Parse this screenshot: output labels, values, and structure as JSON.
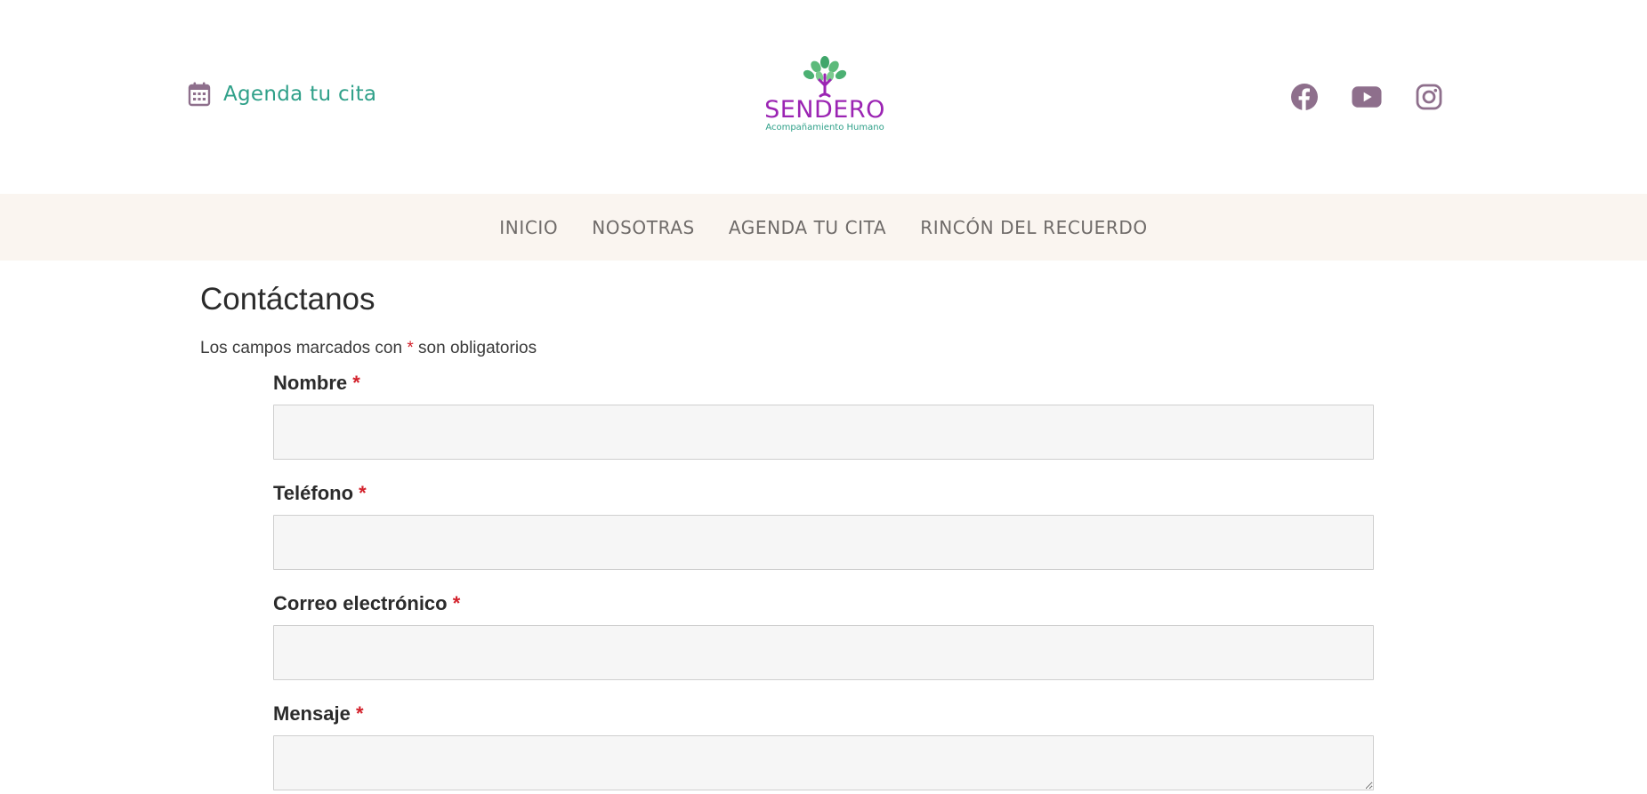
{
  "header": {
    "agenda_link": "Agenda tu cita",
    "logo": {
      "brand": "SENDERO",
      "tagline": "Acompañamiento Humano"
    },
    "social": [
      {
        "name": "facebook-icon"
      },
      {
        "name": "youtube-icon"
      },
      {
        "name": "instagram-icon"
      }
    ]
  },
  "nav": {
    "items": [
      "INICIO",
      "NOSOTRAS",
      "AGENDA TU CITA",
      "RINCÓN DEL RECUERDO"
    ]
  },
  "main": {
    "title": "Contáctanos",
    "required_note_before": "Los campos marcados con",
    "required_note_asterisk": "*",
    "required_note_after": "son obligatorios",
    "fields": [
      {
        "label": "Nombre",
        "asterisk": "*",
        "value": "",
        "placeholder": ""
      },
      {
        "label": "Teléfono",
        "asterisk": "*",
        "value": "",
        "placeholder": ""
      },
      {
        "label": "Correo electrónico",
        "asterisk": "*",
        "value": "",
        "placeholder": ""
      },
      {
        "label": "Mensaje",
        "asterisk": "*",
        "value": "",
        "placeholder": ""
      }
    ]
  },
  "colors": {
    "accent_teal": "#2fa089",
    "brand_purple": "#9b24b3",
    "icon_mauve": "#8e6f8c",
    "nav_bg": "#faf5f0",
    "required_red": "#d3212b"
  }
}
